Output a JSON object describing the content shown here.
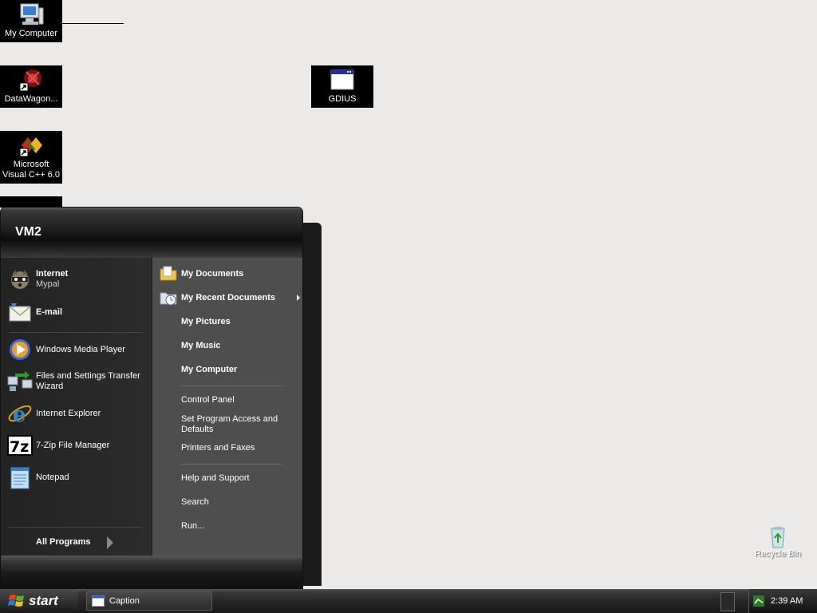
{
  "desktop": {
    "icons": [
      {
        "label": "My Computer"
      },
      {
        "label": "DataWagon..."
      },
      {
        "label": "Microsoft Visual C++ 6.0"
      },
      {
        "label": "GDIUS"
      },
      {
        "label": "Recycle Bin"
      }
    ]
  },
  "start_menu": {
    "user": "VM2",
    "pinned": [
      {
        "title": "Internet",
        "subtitle": "Mypal",
        "icon": "mypal-raccoon-icon"
      },
      {
        "title": "E-mail",
        "icon": "email-envelope-icon"
      }
    ],
    "recent": [
      {
        "label": "Windows Media Player",
        "icon": "media-player-icon"
      },
      {
        "label": "Files and Settings Transfer Wizard",
        "icon": "transfer-wizard-icon"
      },
      {
        "label": "Internet Explorer",
        "icon": "internet-explorer-icon"
      },
      {
        "label": "7-Zip File Manager",
        "icon": "7zip-icon"
      },
      {
        "label": "Notepad",
        "icon": "notepad-icon"
      }
    ],
    "all_programs": "All Programs",
    "places": [
      {
        "label": "My Documents"
      },
      {
        "label": "My Recent Documents"
      },
      {
        "label": "My Pictures"
      },
      {
        "label": "My Music"
      },
      {
        "label": "My Computer"
      }
    ],
    "system": [
      {
        "label": "Control Panel"
      },
      {
        "label": "Set Program Access and Defaults"
      },
      {
        "label": "Printers and Faxes"
      }
    ],
    "help": [
      {
        "label": "Help and Support"
      },
      {
        "label": "Search"
      },
      {
        "label": "Run..."
      }
    ]
  },
  "taskbar": {
    "start_label": "start",
    "window_caption": "Caption",
    "clock": "2:39 AM"
  },
  "colors": {
    "desktop_bg": "#ebeae8",
    "menu_left": "#2a2a2a",
    "menu_right": "#4e4e4e"
  }
}
